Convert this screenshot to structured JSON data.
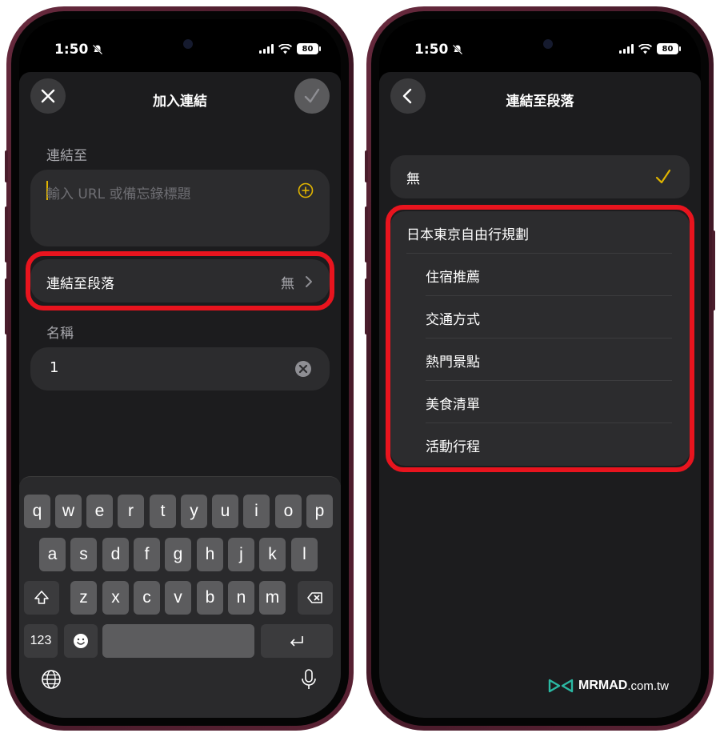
{
  "status": {
    "time": "1:50",
    "battery": "80"
  },
  "left": {
    "title": "加入連結",
    "link_to_label": "連結至",
    "url_placeholder": "輸入 URL 或備忘錄標題",
    "section_row_label": "連結至段落",
    "section_row_value": "無",
    "name_label": "名稱",
    "name_value": "1"
  },
  "keyboard": {
    "row1": [
      "q",
      "w",
      "e",
      "r",
      "t",
      "y",
      "u",
      "i",
      "o",
      "p"
    ],
    "row2": [
      "a",
      "s",
      "d",
      "f",
      "g",
      "h",
      "j",
      "k",
      "l"
    ],
    "row3": [
      "z",
      "x",
      "c",
      "v",
      "b",
      "n",
      "m"
    ],
    "numbers_key": "123"
  },
  "right": {
    "title": "連結至段落",
    "none_option": "無",
    "heading": "日本東京自由行規劃",
    "subsections": [
      "住宿推薦",
      "交通方式",
      "熱門景點",
      "美食清單",
      "活動行程"
    ]
  },
  "watermark": {
    "brand": "MRMAD",
    "domain": ".com.tw"
  },
  "colors": {
    "accent": "#e0b400",
    "highlight": "#e8141e",
    "watermark_icon": "#2bb8a3"
  },
  "icons": [
    "close-icon",
    "checkmark-icon",
    "plus-circle-icon",
    "chevron-right-icon",
    "clear-icon",
    "shift-icon",
    "backspace-icon",
    "emoji-icon",
    "return-icon",
    "globe-icon",
    "microphone-icon",
    "back-chevron-icon",
    "silent-bell-icon"
  ]
}
